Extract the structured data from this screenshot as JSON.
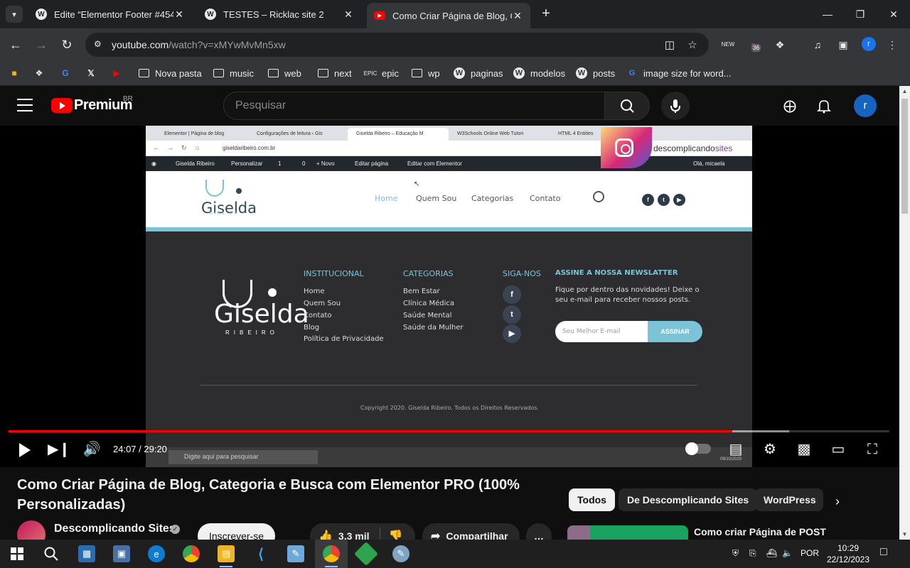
{
  "browser": {
    "tabs": [
      {
        "title": "Edite “Elementor Footer #454” ‹",
        "favicon": "wordpress-icon",
        "active": false
      },
      {
        "title": "TESTES – Ricklac site 2",
        "favicon": "wordpress-icon",
        "active": false
      },
      {
        "title": "Como Criar Página de Blog, Cat",
        "favicon": "youtube-icon",
        "active": true
      }
    ],
    "url_host": "youtube.com",
    "url_path": "/watch?v=xMYwMvMn5xw",
    "extension_badge": "36",
    "profile_initial": "r",
    "bookmarks": [
      {
        "label": "",
        "icon": "photos-icon"
      },
      {
        "label": "",
        "icon": "puzzle-icon"
      },
      {
        "label": "",
        "icon": "google-icon"
      },
      {
        "label": "",
        "icon": "x-icon"
      },
      {
        "label": "",
        "icon": "youtube-icon"
      },
      {
        "label": "Nova pasta",
        "icon": "folder-icon"
      },
      {
        "label": "music",
        "icon": "folder-icon"
      },
      {
        "label": "web",
        "icon": "folder-icon"
      },
      {
        "label": "next",
        "icon": "folder-icon"
      },
      {
        "label": "epic",
        "icon": "epic-icon"
      },
      {
        "label": "wp",
        "icon": "folder-icon"
      },
      {
        "label": "paginas",
        "icon": "wordpress-icon"
      },
      {
        "label": "modelos",
        "icon": "wordpress-icon"
      },
      {
        "label": "posts",
        "icon": "wordpress-icon"
      },
      {
        "label": "image size for word...",
        "icon": "google-icon"
      }
    ]
  },
  "youtube": {
    "logo_text": "Premium",
    "country_code": "BR",
    "search_placeholder": "Pesquisar",
    "avatar_initial": "r",
    "player": {
      "current_time": "24:07",
      "duration": "29:20",
      "time_display": "24:07 / 29:20",
      "progress_fraction": 0.822,
      "buffered_fraction": 0.886
    },
    "video": {
      "title": "Como Criar Página de Blog, Categoria e Busca com Elementor PRO (100% Personalizadas)",
      "channel_name": "Descomplicando Sites",
      "subscribe_label": "Inscrever-se",
      "likes": "3,3 mil",
      "share_label": "Compartilhar",
      "more_label": "…"
    },
    "chips": [
      "Todos",
      "De Descomplicando Sites",
      "WordPress"
    ],
    "recommendation_title": "Como criar Página de POST"
  },
  "video_frame": {
    "tabs": [
      "Elementor | Página de blog",
      "Configurações de leitura ‹ Gis",
      "Giselda Ribeiro – Educação M",
      "W3Schools Online Web Tutori",
      "HTML 4 Entities"
    ],
    "url": "giseldaribeiro.com.br",
    "wp_bar": [
      "Giselda Ribeiro",
      "Personalizar",
      "1",
      "0",
      "+ Novo",
      "Editar página",
      "Editar com Elementor",
      "Olá, micaela"
    ],
    "site_logo": "Giselda",
    "site_logo_sub": "RIBEIRO",
    "menu": [
      "Home",
      "Quem Sou",
      "Categorias",
      "Contato"
    ],
    "footer": {
      "col_institucional": {
        "heading": "INSTITUCIONAL",
        "links": [
          "Home",
          "Quem Sou",
          "Contato",
          "Blog",
          "Política de Privacidade"
        ]
      },
      "col_categorias": {
        "heading": "CATEGORIAS",
        "links": [
          "Bem Estar",
          "Clínica Médica",
          "Saúde Mental",
          "Saúde da Mulher"
        ]
      },
      "col_siga": {
        "heading": "SIGA-NOS"
      },
      "newsletter_heading": "ASSINE A NOSSA NEWSLATTER",
      "newsletter_text": "Fique por dentro das novidades! Deixe o seu e-mail para receber nossos posts.",
      "newsletter_placeholder": "Seu Melhor E-mail",
      "newsletter_button": "ASSINAR",
      "copyright": "Copyright 2020. Giselda Ribeiro. Todos os Direitos Reservados."
    },
    "watermark_prefix": "descomplicando",
    "watermark_suffix": "sites",
    "taskbar_search": "Digite aqui para pesquisar",
    "taskbar_date": "09/10/2020"
  },
  "taskbar": {
    "language": "POR",
    "time": "10:29",
    "date": "22/12/2023"
  }
}
